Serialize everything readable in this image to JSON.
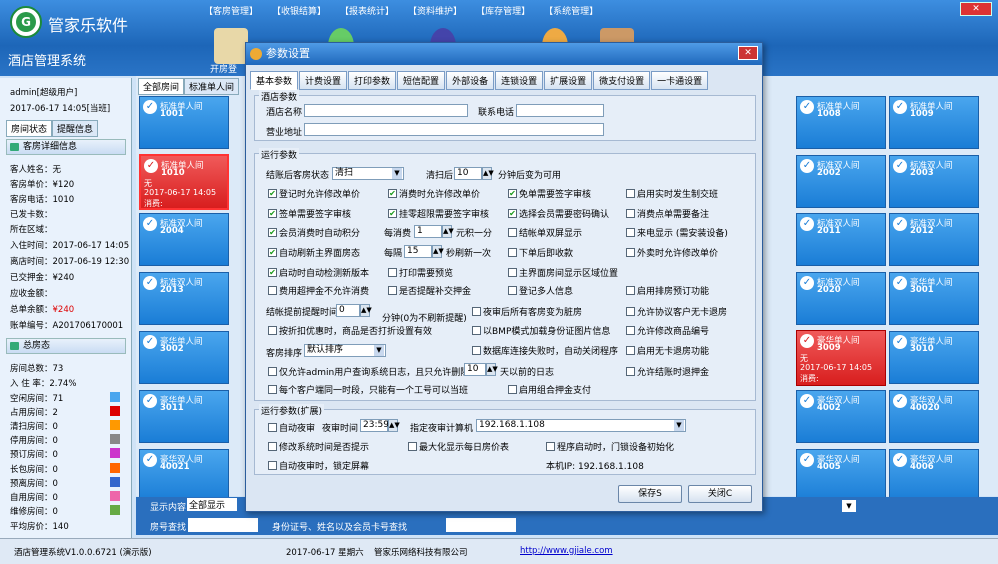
{
  "app": {
    "brand": "管家乐软件",
    "name": "酒店管理系统"
  },
  "menu": [
    "【客房管理】",
    "【收银结算】",
    "【报表统计】",
    "【资料维护】",
    "【库存管理】",
    "【系统管理】"
  ],
  "toolbar": {
    "open_room": "开房登"
  },
  "left": {
    "user": "admin[超级用户]",
    "datetime": "2017-06-17 14:05[当班]",
    "tabs": [
      "房间状态",
      "提醒信息"
    ],
    "section1": "客房详细信息",
    "details": [
      "客人姓名：无",
      "客房单价：¥120",
      "客房电话：1010",
      "已发卡数：",
      "所在区域：",
      "入住时间：2017-06-17 14:05",
      "离店时间：2017-06-19 12:30",
      "已交押金：¥240",
      "应收金额：",
      "总单余额：",
      "账单编号：A201706170001"
    ],
    "balance": "¥240",
    "section2": "总房态",
    "stats": [
      "房间总数：73",
      "入 住 率：2.74%",
      "空闲房间：71",
      "占用房间：2",
      "清扫房间：0",
      "停用房间：0",
      "预订房间：0",
      "长包房间：0",
      "预离房间：0",
      "自用房间：0",
      "维修房间：0",
      "平均房价：140"
    ]
  },
  "rooms": {
    "tabs": [
      "全部房间",
      "标准单人间"
    ],
    "items": [
      {
        "name": "标准单人间",
        "no": "1001"
      },
      {
        "name": "标准单人间",
        "no": "1010",
        "extra1": "无",
        "extra2": "2017-06-17 14:05",
        "extra3": "消费:"
      },
      {
        "name": "标准双人间",
        "no": "2004"
      },
      {
        "name": "标准双人间",
        "no": "2013"
      },
      {
        "name": "豪华单人间",
        "no": "3002"
      },
      {
        "name": "豪华单人间",
        "no": "3011"
      },
      {
        "name": "豪华双人间",
        "no": "40021"
      },
      {
        "name": "标准单人间",
        "no": "1008"
      },
      {
        "name": "标准单人间",
        "no": "1009"
      },
      {
        "name": "标准双人间",
        "no": "2002"
      },
      {
        "name": "标准双人间",
        "no": "2003"
      },
      {
        "name": "标准双人间",
        "no": "2011"
      },
      {
        "name": "标准双人间",
        "no": "2012"
      },
      {
        "name": "标准双人间",
        "no": "2020"
      },
      {
        "name": "豪华单人间",
        "no": "3001"
      },
      {
        "name": "豪华单人间",
        "no": "3009",
        "extra1": "无",
        "extra2": "2017-06-17 14:05",
        "extra3": "消费:"
      },
      {
        "name": "豪华单人间",
        "no": "3010"
      },
      {
        "name": "豪华双人间",
        "no": "4002"
      },
      {
        "name": "豪华双人间",
        "no": "40020"
      },
      {
        "name": "豪华双人间",
        "no": "4005"
      },
      {
        "name": "豪华双人间",
        "no": "4006"
      }
    ]
  },
  "bottom": {
    "show_label": "显示内容",
    "show_value": "全部显示",
    "room_search": "房号查找",
    "id_search": "身份证号、姓名以及会员卡号查找"
  },
  "status": {
    "version": "酒店管理系统V1.0.0.6721 (演示版)",
    "date": "2017-06-17 星期六",
    "company": "管家乐网络科技有限公司",
    "url": "http://www.gjiale.com"
  },
  "dialog": {
    "title": "参数设置",
    "tabs": [
      "基本参数",
      "计费设置",
      "打印参数",
      "短信配置",
      "外部设备",
      "连锁设置",
      "扩展设置",
      "微支付设置",
      "一卡通设置"
    ],
    "hotel_group": "酒店参数",
    "hotel_name": "酒店名称",
    "phone": "联系电话",
    "address": "营业地址",
    "run_group": "运行参数",
    "after_checkout": "结账后客房状态",
    "after_checkout_value": "清扫",
    "clean_after": "清扫后",
    "clean_minutes": "10",
    "clean_suffix": "分钟后变为可用",
    "options": [
      "登记时允许修改单价",
      "消费时允许修改单价",
      "免单需要签字审核",
      "启用实时发生制交班",
      "签单需要签字审核",
      "挂零超限需要签字审核",
      "选择会员需要密码确认",
      "消费点单需要备注",
      "会员消费时自动积分",
      "结帐单双屏显示",
      "来电显示 (需安装设备)",
      "自动刷新主界面房态",
      "下单后即收款",
      "外卖时允许修改单价",
      "启动时自动检测新版本",
      "打印需要预览",
      "主界面房间显示区域位置",
      "费用超押金不允许消费",
      "是否提醒补交押金",
      "登记多人信息",
      "启用排房预订功能",
      "夜审后所有客房变为脏房",
      "允许协议客户无卡退房",
      "按折扣优惠时，商品是否打折设置有效",
      "以BMP模式加载身份证图片信息",
      "允许修改商品编号",
      "数据库连接失败时，自动关闭程序",
      "启用无卡退房功能",
      "仅允许admin用户查询系统日志，且只允许删除",
      "天以前的日志",
      "允许结账时退押金",
      "每个客户端同一时段，只能有一个工号可以当班",
      "启用组合押金支付"
    ],
    "per_consume": "每消费",
    "per_consume_value": "1",
    "per_consume_suffix": "元积一分",
    "every": "每隔",
    "every_value": "15",
    "every_suffix": "秒刷新一次",
    "remind_label": "结帐提前提醒时间",
    "remind_value": "0",
    "remind_suffix": "分钟(0为不刷新提醒)",
    "room_sort": "客房排序",
    "room_sort_value": "默认排序",
    "log_days": "10",
    "ext_group": "运行参数(扩展)",
    "auto_night": "自动夜审",
    "night_time_label": "夜审时间",
    "night_time": "23:59",
    "night_pc_label": "指定夜审计算机",
    "night_pc": "192.168.1.108",
    "ext_options": [
      "修改系统时间是否提示",
      "最大化显示每日房价表",
      "程序启动时，门锁设备初始化",
      "自动夜审时，锁定屏幕"
    ],
    "local_ip": "本机IP: 192.168.1.108",
    "save": "保存S",
    "close": "关闭C"
  }
}
